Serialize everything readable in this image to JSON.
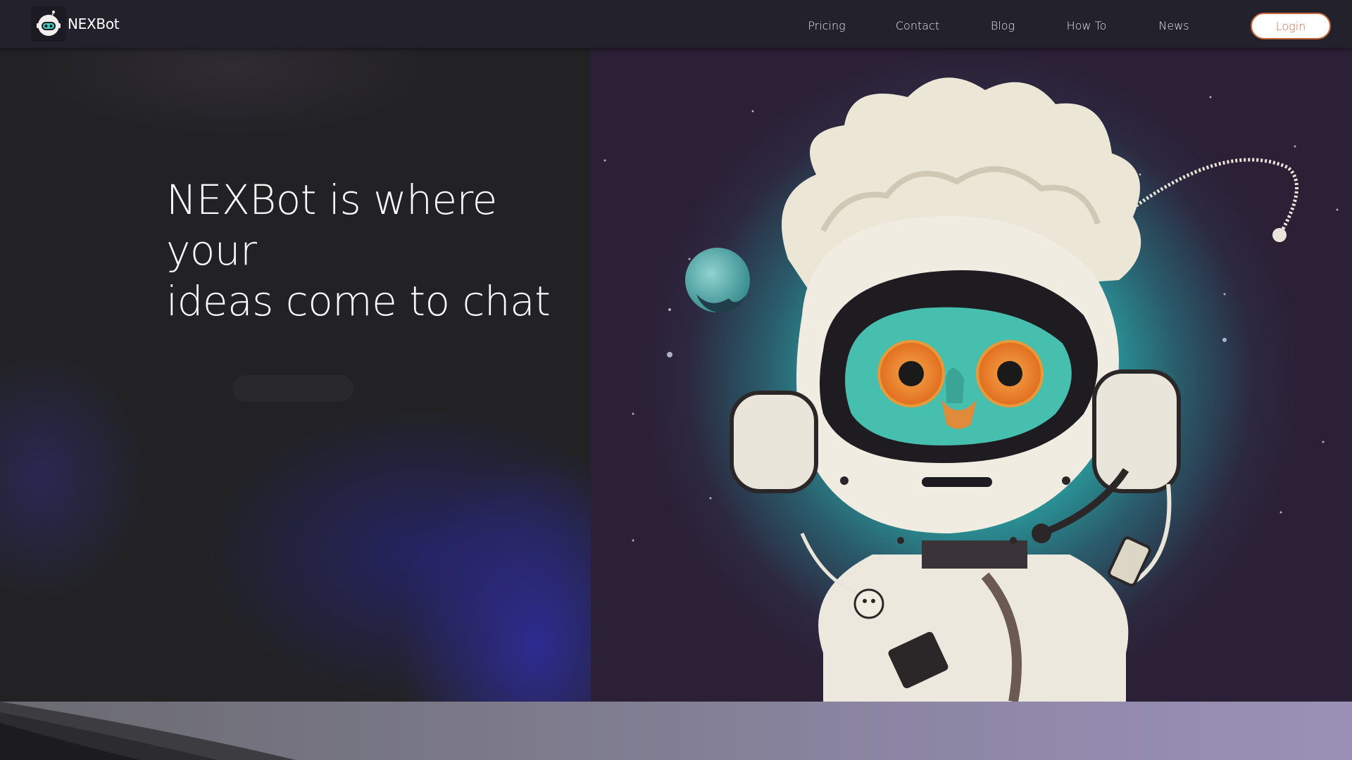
{
  "brand": {
    "name": "NEXBot",
    "logo_icon": "robot-astronaut-logo-icon"
  },
  "nav": {
    "items": [
      {
        "label": "Pricing"
      },
      {
        "label": "Contact"
      },
      {
        "label": "Blog"
      },
      {
        "label": "How To"
      },
      {
        "label": "News"
      }
    ],
    "login_label": "Login"
  },
  "hero": {
    "title_line1": "NEXBot is where your",
    "title_line2": "ideas come to chat",
    "image": "astronaut-alien-illustration"
  },
  "colors": {
    "header_bg": "#23212b",
    "hero_left_bg": "#222224",
    "accent_login": "#c9683d",
    "hero_right_bg": "#2b2036"
  }
}
